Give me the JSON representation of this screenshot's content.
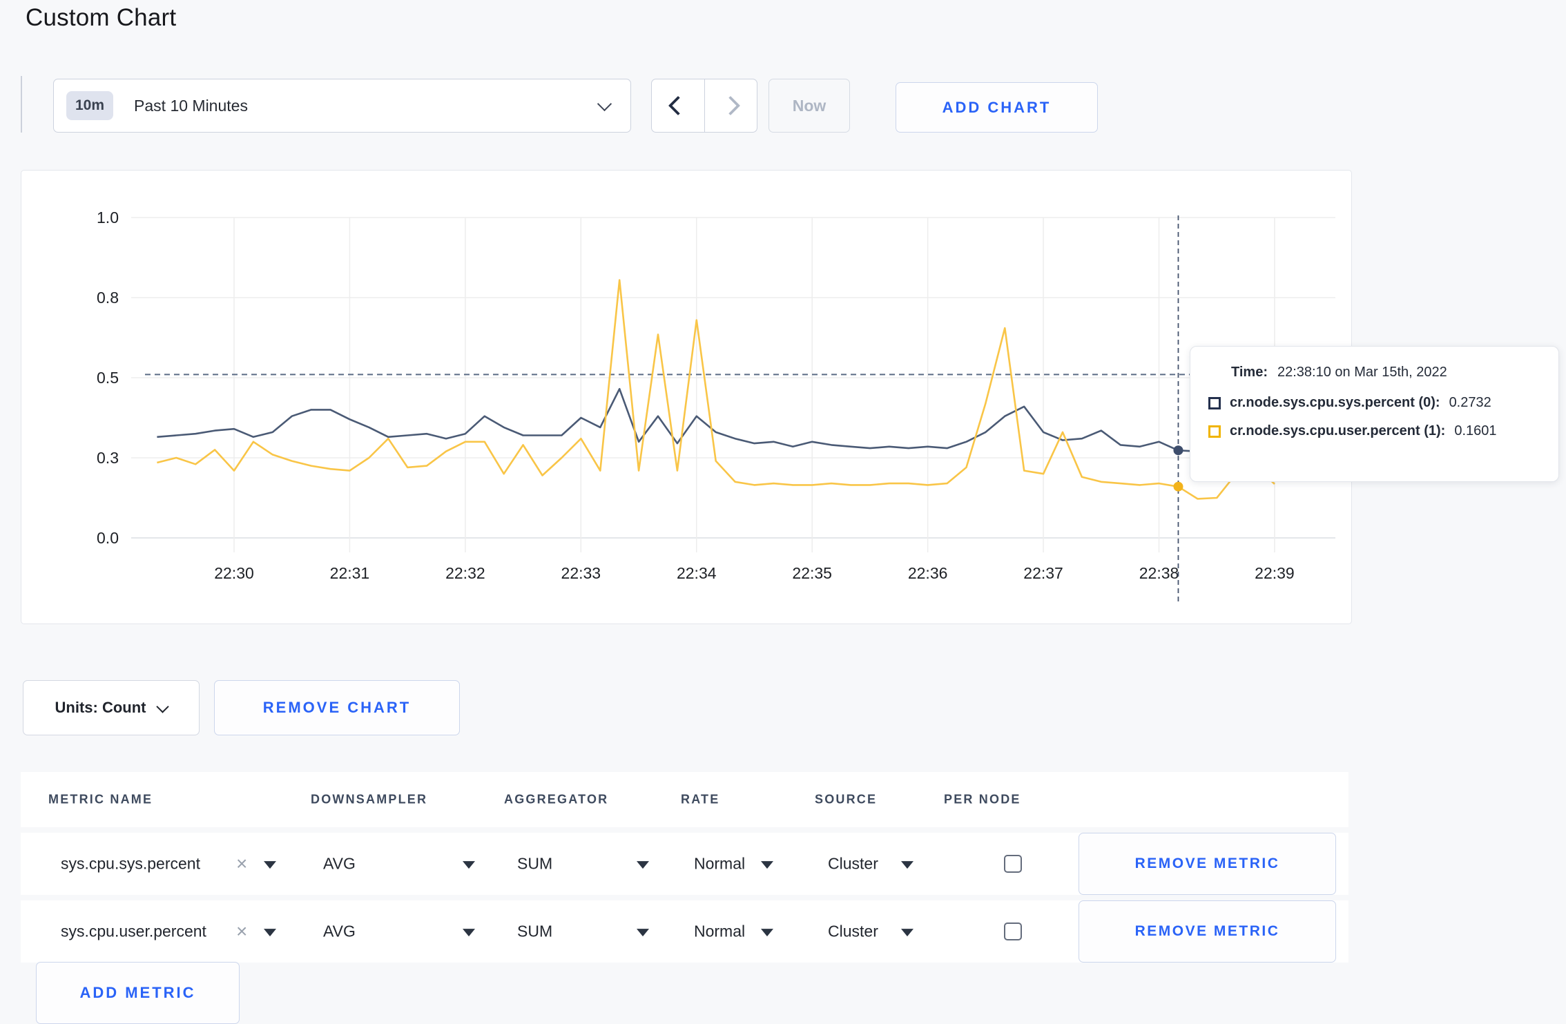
{
  "page": {
    "title": "Custom Chart"
  },
  "toolbar": {
    "time_range": {
      "badge": "10m",
      "label": "Past 10 Minutes"
    },
    "now_label": "Now",
    "add_chart_label": "ADD CHART"
  },
  "units": {
    "label": "Units: Count"
  },
  "remove_chart_label": "REMOVE CHART",
  "tooltip": {
    "time_label": "Time:",
    "time_value": "22:38:10 on Mar 15th, 2022",
    "series": [
      {
        "name": "cr.node.sys.cpu.sys.percent (0):",
        "value": "0.2732",
        "color": "#24304d"
      },
      {
        "name": "cr.node.sys.cpu.user.percent (1):",
        "value": "0.1601",
        "color": "#f0b400"
      }
    ]
  },
  "metrics_table": {
    "headers": [
      "METRIC NAME",
      "DOWNSAMPLER",
      "AGGREGATOR",
      "RATE",
      "SOURCE",
      "PER NODE"
    ],
    "rows": [
      {
        "metric": "sys.cpu.sys.percent",
        "downsampler": "AVG",
        "aggregator": "SUM",
        "rate": "Normal",
        "source": "Cluster",
        "per_node_checked": false,
        "remove_label": "REMOVE METRIC"
      },
      {
        "metric": "sys.cpu.user.percent",
        "downsampler": "AVG",
        "aggregator": "SUM",
        "rate": "Normal",
        "source": "Cluster",
        "per_node_checked": false,
        "remove_label": "REMOVE METRIC"
      }
    ],
    "add_metric_label": "ADD METRIC"
  },
  "chart_data": {
    "type": "line",
    "title": "",
    "xlabel": "",
    "ylabel": "",
    "ylim": [
      0,
      1
    ],
    "grid": true,
    "legend_position": "tooltip",
    "x_ticks": [
      "22:30",
      "22:31",
      "22:32",
      "22:33",
      "22:34",
      "22:35",
      "22:36",
      "22:37",
      "22:38",
      "22:39"
    ],
    "y_ticks": {
      "values": [
        0,
        0.25,
        0.5,
        0.75,
        1.0
      ],
      "labels": [
        "0.0",
        "0.3",
        "0.5",
        "0.8",
        "1.0"
      ]
    },
    "times": [
      "22:29:20",
      "22:29:30",
      "22:29:40",
      "22:29:50",
      "22:30:00",
      "22:30:10",
      "22:30:20",
      "22:30:30",
      "22:30:40",
      "22:30:50",
      "22:31:00",
      "22:31:10",
      "22:31:20",
      "22:31:30",
      "22:31:40",
      "22:31:50",
      "22:32:00",
      "22:32:10",
      "22:32:20",
      "22:32:30",
      "22:32:40",
      "22:32:50",
      "22:33:00",
      "22:33:10",
      "22:33:20",
      "22:33:30",
      "22:33:40",
      "22:33:50",
      "22:34:00",
      "22:34:10",
      "22:34:20",
      "22:34:30",
      "22:34:40",
      "22:34:50",
      "22:35:00",
      "22:35:10",
      "22:35:20",
      "22:35:30",
      "22:35:40",
      "22:35:50",
      "22:36:00",
      "22:36:10",
      "22:36:20",
      "22:36:30",
      "22:36:40",
      "22:36:50",
      "22:37:00",
      "22:37:10",
      "22:37:20",
      "22:37:30",
      "22:37:40",
      "22:37:50",
      "22:38:00",
      "22:38:10",
      "22:38:20",
      "22:38:30",
      "22:38:40",
      "22:38:50",
      "22:39:00"
    ],
    "series": [
      {
        "name": "cr.node.sys.cpu.sys.percent",
        "color": "#4a5a75",
        "values": [
          0.315,
          0.32,
          0.325,
          0.335,
          0.34,
          0.315,
          0.33,
          0.38,
          0.4,
          0.4,
          0.37,
          0.345,
          0.315,
          0.32,
          0.325,
          0.31,
          0.325,
          0.38,
          0.345,
          0.32,
          0.32,
          0.32,
          0.375,
          0.345,
          0.465,
          0.3,
          0.38,
          0.295,
          0.38,
          0.33,
          0.31,
          0.295,
          0.3,
          0.285,
          0.3,
          0.29,
          0.285,
          0.28,
          0.285,
          0.28,
          0.285,
          0.28,
          0.3,
          0.33,
          0.38,
          0.41,
          0.33,
          0.305,
          0.31,
          0.335,
          0.29,
          0.285,
          0.3,
          0.273,
          0.27,
          0.28,
          0.29,
          0.285,
          0.29
        ]
      },
      {
        "name": "cr.node.sys.cpu.user.percent",
        "color": "#f9c547",
        "values": [
          0.235,
          0.25,
          0.23,
          0.275,
          0.21,
          0.3,
          0.26,
          0.24,
          0.225,
          0.215,
          0.21,
          0.25,
          0.31,
          0.22,
          0.225,
          0.27,
          0.3,
          0.3,
          0.2,
          0.29,
          0.195,
          0.25,
          0.31,
          0.21,
          0.805,
          0.21,
          0.635,
          0.21,
          0.68,
          0.24,
          0.175,
          0.165,
          0.17,
          0.165,
          0.165,
          0.17,
          0.165,
          0.165,
          0.17,
          0.17,
          0.165,
          0.17,
          0.22,
          0.42,
          0.655,
          0.21,
          0.2,
          0.33,
          0.19,
          0.175,
          0.17,
          0.165,
          0.17,
          0.16,
          0.122,
          0.125,
          0.2,
          0.225,
          0.168
        ]
      }
    ],
    "hover": {
      "time": "22:38:10",
      "index": 53,
      "values": [
        0.2732,
        0.1601
      ],
      "dot_colors": [
        "#3d4d6c",
        "#f2b31c"
      ],
      "guideline_y": 0.51
    }
  }
}
